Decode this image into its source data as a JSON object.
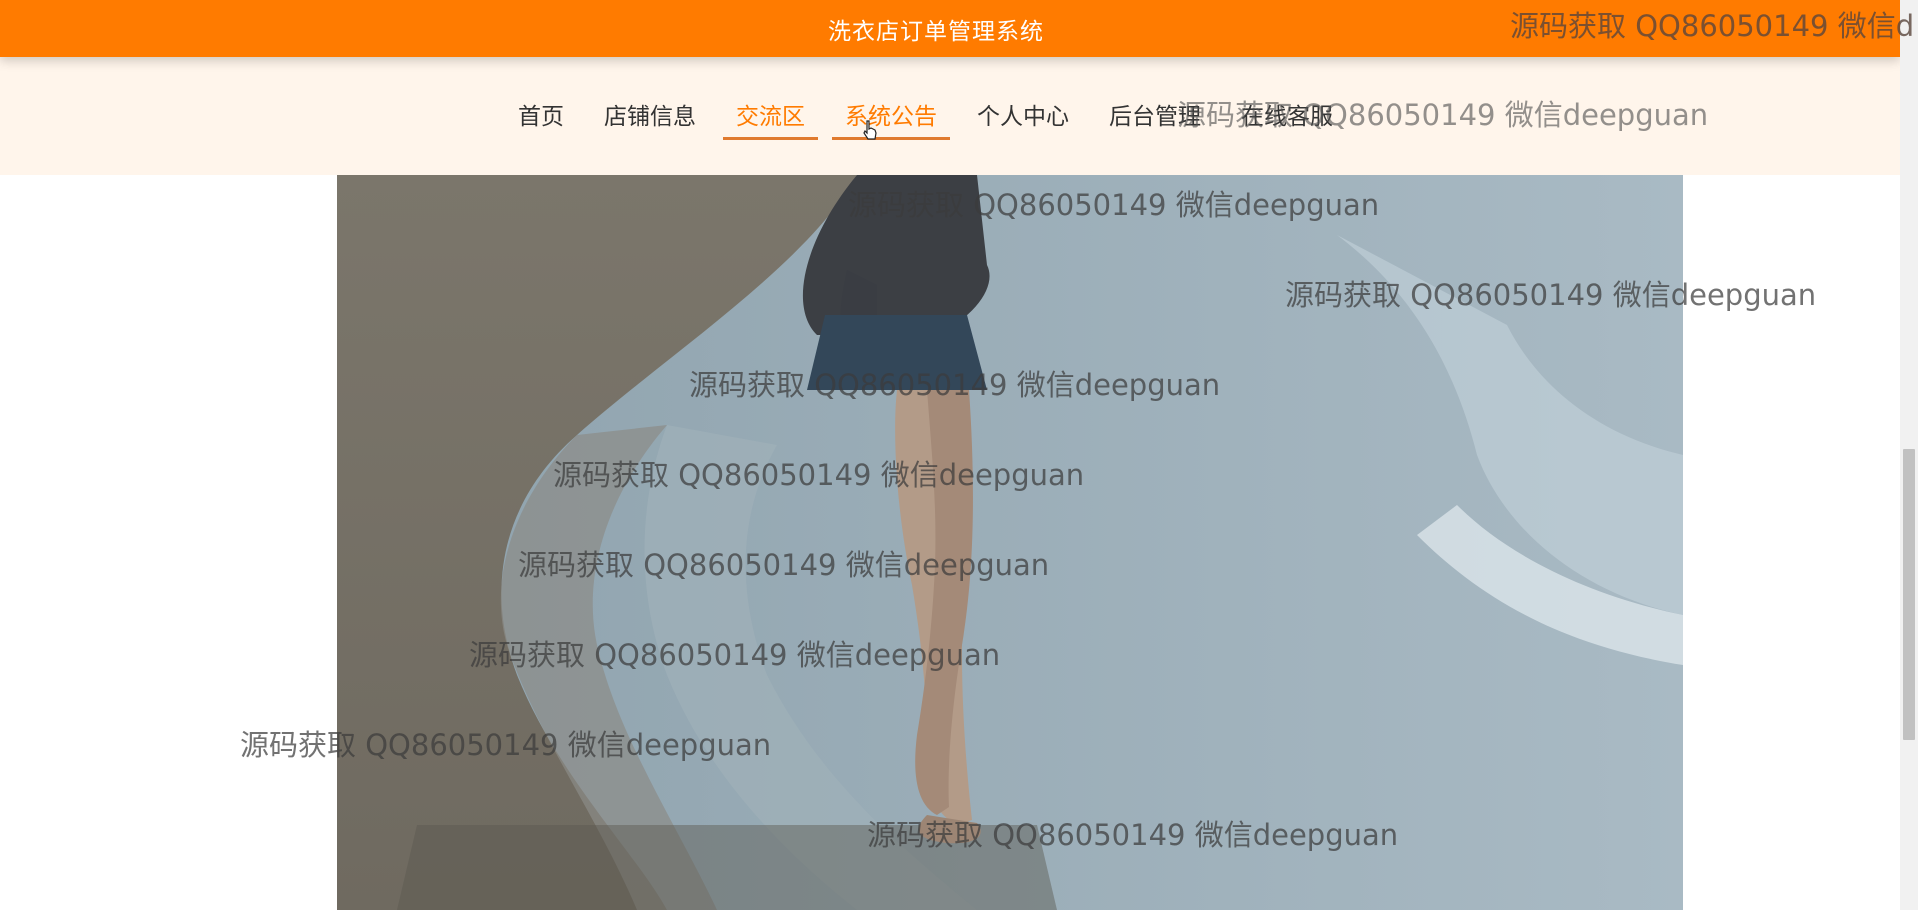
{
  "header": {
    "title": "洗衣店订单管理系统"
  },
  "nav": {
    "items": [
      {
        "label": "首页",
        "active": false
      },
      {
        "label": "店铺信息",
        "active": false
      },
      {
        "label": "交流区",
        "active": true
      },
      {
        "label": "系统公告",
        "active": true
      },
      {
        "label": "个人中心",
        "active": false
      },
      {
        "label": "后台管理",
        "active": false
      },
      {
        "label": "在线客服",
        "active": false
      }
    ]
  },
  "watermarks": [
    "源码获取 QQ86050149 微信d",
    "源码获取 QQ86050149 微信deepguan",
    "源码获取 QQ86050149 微信deepguan",
    "源码获取 QQ86050149 微信deepguan",
    "源码获取 QQ86050149 微信deepguan",
    "源码获取 QQ86050149 微信deepguan",
    "源码获取 QQ86050149 微信deepguan",
    "源码获取 QQ86050149 微信deepguan",
    "源码获取 QQ86050149 微信deepguan",
    "源码获取 QQ86050149 微信deepguan"
  ],
  "colors": {
    "brand": "#ff7b00",
    "nav_bg": "#fff5eb",
    "active_underline": "#e07a2e"
  }
}
